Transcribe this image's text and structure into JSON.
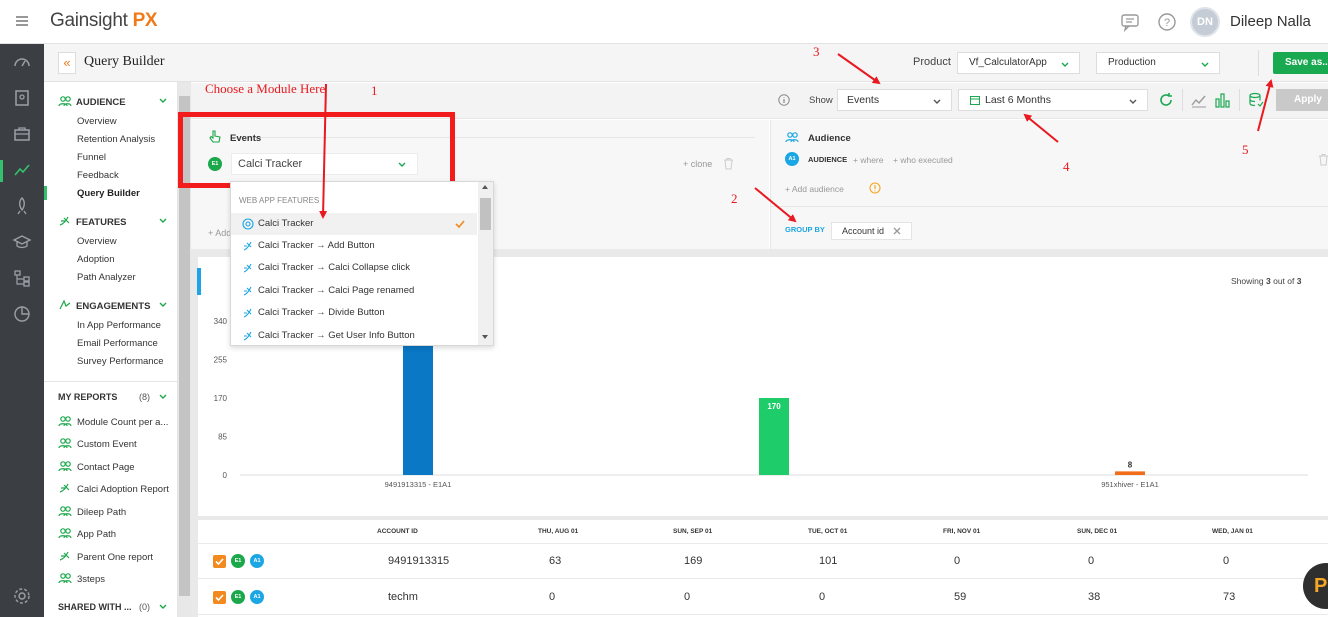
{
  "app": {
    "logo_text": "Gainsight",
    "logo_suffix": "PX"
  },
  "user": {
    "initials": "DN",
    "name": "Dileep Nalla"
  },
  "page": {
    "title": "Query Builder"
  },
  "header_controls": {
    "product_label": "Product",
    "product_value": "Vf_CalculatorApp",
    "environment_value": "Production",
    "save_label": "Save as..."
  },
  "toolbar": {
    "show_label": "Show",
    "show_value": "Events",
    "range_value": "Last 6 Months",
    "apply_label": "Apply"
  },
  "sidebar": {
    "audience": {
      "title": "AUDIENCE",
      "items": [
        "Overview",
        "Retention Analysis",
        "Funnel",
        "Feedback",
        "Query Builder"
      ]
    },
    "features": {
      "title": "FEATURES",
      "items": [
        "Overview",
        "Adoption",
        "Path Analyzer"
      ]
    },
    "engagements": {
      "title": "ENGAGEMENTS",
      "items": [
        "In App Performance",
        "Email Performance",
        "Survey Performance"
      ]
    },
    "my_reports": {
      "title": "MY REPORTS",
      "count": "(8)",
      "items": [
        "Module Count per a...",
        "Custom Event",
        "Contact Page",
        "Calci Adoption Report",
        "Dileep Path",
        "App Path",
        "Parent One report",
        "3steps"
      ]
    },
    "shared": {
      "title": "SHARED WITH ...",
      "count": "(0)"
    }
  },
  "events_panel": {
    "title": "Events",
    "badge": "E1",
    "selected_module": "Calci Tracker",
    "clone_label": "+ clone",
    "add_label": "+ Add"
  },
  "audience_panel": {
    "title": "Audience",
    "badge": "A1",
    "label": "AUDIENCE",
    "where_label": "+ where",
    "who_label": "+ who executed",
    "add_label": "+ Add audience",
    "group_by_label": "GROUP BY",
    "group_by_chip": "Account id"
  },
  "dropdown": {
    "header": "WEB APP FEATURES",
    "items": [
      "Calci Tracker",
      "Calci Tracker → Add Button",
      "Calci Tracker → Calci Collapse click",
      "Calci Tracker → Calci Page renamed",
      "Calci Tracker → Divide Button",
      "Calci Tracker → Get User Info Button"
    ],
    "selected_index": 0
  },
  "chart_meta": {
    "showing_prefix": "Showing",
    "showing_count": "3",
    "showing_mid": "out of",
    "showing_total": "3"
  },
  "chart_data": {
    "type": "bar",
    "categories": [
      "9491913315 - E1A1",
      "",
      "951xhiver - E1A1"
    ],
    "values": [
      340,
      170,
      8
    ],
    "value_labels": [
      "",
      "170",
      "8"
    ],
    "ylim": [
      0,
      340
    ],
    "yticks": [
      0,
      85,
      170,
      255,
      340
    ],
    "colors": [
      "#0a78c4",
      "#1fcc6a",
      "#f26d1a"
    ],
    "title": "",
    "xlabel": "",
    "ylabel": ""
  },
  "table": {
    "columns": [
      "ACCOUNT ID",
      "THU, AUG 01",
      "SUN, SEP 01",
      "TUE, OCT 01",
      "FRI, NOV 01",
      "SUN, DEC 01",
      "WED, JAN 01"
    ],
    "rows": [
      {
        "badges": [
          "E1",
          "A1"
        ],
        "cells": [
          "9491913315",
          "63",
          "169",
          "101",
          "0",
          "0",
          "0"
        ]
      },
      {
        "badges": [
          "E1",
          "A1"
        ],
        "cells": [
          "techm",
          "0",
          "0",
          "0",
          "59",
          "38",
          "73"
        ]
      }
    ]
  },
  "annotations": {
    "choose_text": "Choose a Module Here",
    "n1": "1",
    "n2": "2",
    "n3": "3",
    "n4": "4",
    "n5": "5"
  },
  "floating_button": {
    "label": "P"
  },
  "colors": {
    "accent_green": "#19a950",
    "accent_orange": "#f07a1a",
    "annotation_red": "#e8191f",
    "rail": "#3b3f43"
  }
}
